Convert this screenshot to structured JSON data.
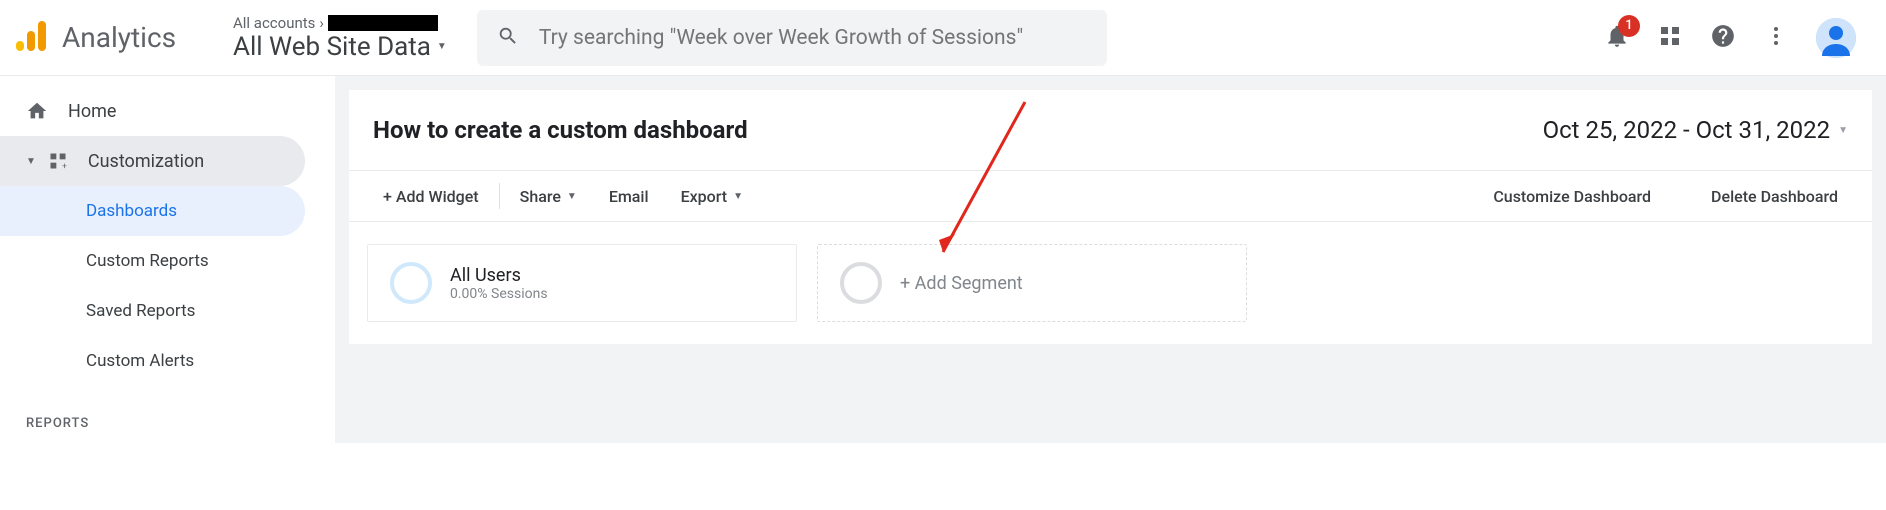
{
  "header": {
    "product_name": "Analytics",
    "breadcrumb_prefix": "All accounts",
    "view_name": "All Web Site Data",
    "search_placeholder": "Try searching \"Week over Week Growth of Sessions\"",
    "notification_count": "1"
  },
  "sidebar": {
    "home": "Home",
    "customization": "Customization",
    "items": [
      "Dashboards",
      "Custom Reports",
      "Saved Reports",
      "Custom Alerts"
    ],
    "reports_label": "REPORTS"
  },
  "dashboard": {
    "title": "How to create a custom dashboard",
    "date_range": "Oct 25, 2022 - Oct 31, 2022",
    "toolbar": {
      "add_widget": "+ Add Widget",
      "share": "Share",
      "email": "Email",
      "export": "Export",
      "customize": "Customize Dashboard",
      "delete": "Delete Dashboard"
    },
    "segments": {
      "all_users_title": "All Users",
      "all_users_sub": "0.00% Sessions",
      "add_segment": "+ Add Segment"
    }
  }
}
